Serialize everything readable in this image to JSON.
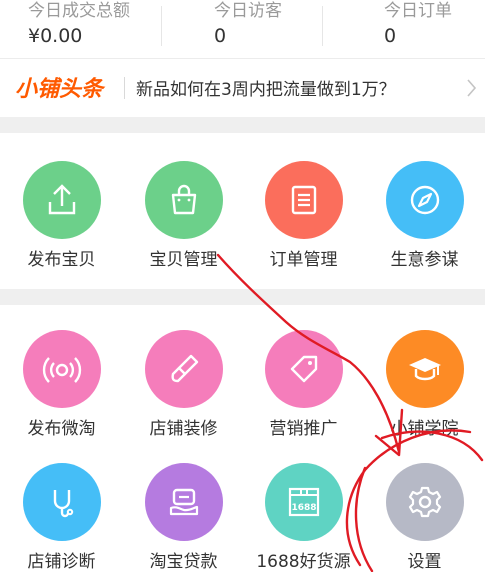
{
  "stats": [
    {
      "label": "今日成交总额",
      "value": "¥0.00"
    },
    {
      "label": "今日访客",
      "value": "0"
    },
    {
      "label": "今日订单",
      "value": "0"
    }
  ],
  "news": {
    "brand": "小铺头条",
    "headline": "新品如何在3周内把流量做到1万？"
  },
  "section1": [
    {
      "label": "发布宝贝",
      "icon": "upload-icon",
      "color": "#6cd08a"
    },
    {
      "label": "宝贝管理",
      "icon": "bag-icon",
      "color": "#6cd08a"
    },
    {
      "label": "订单管理",
      "icon": "order-list-icon",
      "color": "#fb6e5c"
    },
    {
      "label": "生意参谋",
      "icon": "compass-icon",
      "color": "#45bef7"
    }
  ],
  "section2": [
    {
      "label": "发布微淘",
      "icon": "broadcast-icon",
      "color": "#f57dbb"
    },
    {
      "label": "店铺装修",
      "icon": "brush-icon",
      "color": "#f57dbb"
    },
    {
      "label": "营销推广",
      "icon": "tag-icon",
      "color": "#f57dbb"
    },
    {
      "label": "小铺学院",
      "icon": "graduation-cap-icon",
      "color": "#fd8b25"
    },
    {
      "label": "店铺诊断",
      "icon": "stethoscope-icon",
      "color": "#45bef7"
    },
    {
      "label": "淘宝贷款",
      "icon": "loan-hand-icon",
      "color": "#b57be0"
    },
    {
      "label": "1688好货源",
      "icon": "box-1688-icon",
      "color": "#5fd3c3"
    },
    {
      "label": "设置",
      "icon": "gear-icon",
      "color": "#b6b9c6"
    }
  ],
  "box_1688_text": "1688",
  "annotation_color": "#e01b24"
}
